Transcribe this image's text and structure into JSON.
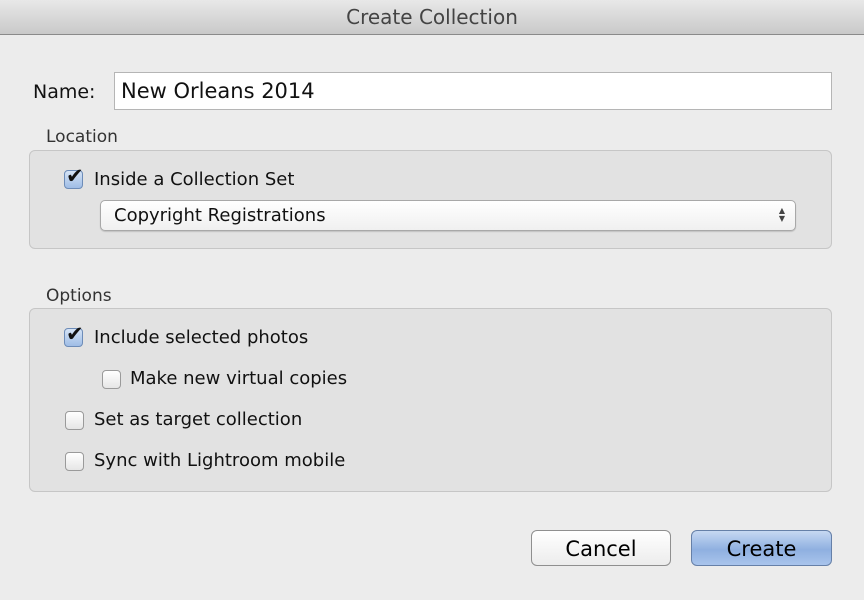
{
  "window": {
    "title": "Create Collection"
  },
  "name": {
    "label": "Name:",
    "value": "New Orleans 2014"
  },
  "location": {
    "label": "Location",
    "inside_set": {
      "label": "Inside a Collection Set",
      "checked": true
    },
    "collection_set": {
      "selected": "Copyright Registrations"
    }
  },
  "options": {
    "label": "Options",
    "items": [
      {
        "label": "Include selected photos",
        "checked": true
      },
      {
        "label": "Make new virtual copies",
        "checked": false
      },
      {
        "label": "Set as target collection",
        "checked": false
      },
      {
        "label": "Sync with Lightroom mobile",
        "checked": false
      }
    ]
  },
  "buttons": {
    "cancel": "Cancel",
    "create": "Create"
  },
  "colors": {
    "accent": "#9fbde6"
  }
}
